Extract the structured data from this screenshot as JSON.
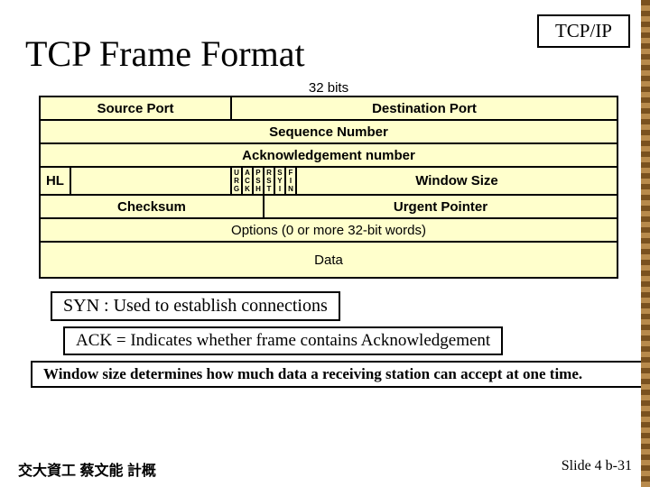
{
  "header_box": "TCP/IP",
  "title": "TCP Frame Format",
  "bits_label": "32 bits",
  "row1": {
    "src": "Source Port",
    "dst": "Destination Port"
  },
  "row2": "Sequence Number",
  "row3": "Acknowledgement number",
  "row4": {
    "hl": "HL",
    "flags": [
      "U\nR\nG",
      "A\nC\nK",
      "P\nS\nH",
      "R\nS\nT",
      "S\nY\nI",
      "F\nI\nN"
    ],
    "win": "Window Size"
  },
  "row5": {
    "chk": "Checksum",
    "urg": "Urgent Pointer"
  },
  "row6": "Options (0 or more 32-bit words)",
  "row7": "Data",
  "note1": "SYN :  Used to establish connections",
  "note2": "ACK = Indicates whether frame contains Acknowledgement",
  "note3": "Window size determines how much data a receiving station can accept at one time.",
  "footerL": "交大資工 蔡文能 計概",
  "footerR": "Slide 4 b-31"
}
